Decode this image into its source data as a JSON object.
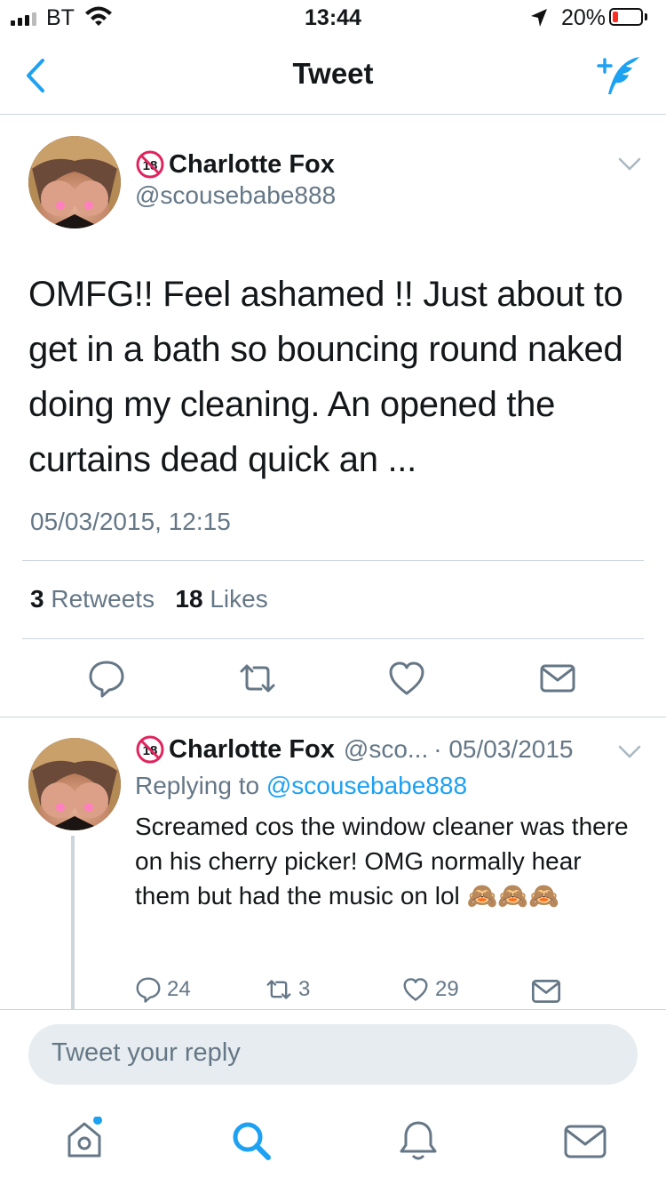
{
  "status_bar": {
    "carrier": "BT",
    "time": "13:44",
    "battery_percent": "20%",
    "battery_level": 0.2,
    "battery_color": "#ff2d20"
  },
  "nav": {
    "title": "Tweet",
    "back_icon": "chevron-left-icon",
    "compose_icon": "compose-tweet-icon",
    "accent": "#1da1f2"
  },
  "tweet": {
    "name": "Charlotte Fox",
    "handle": "@scousebabe888",
    "badge_icon": "eighteen-plus-icon",
    "text": "OMFG!!  Feel ashamed !!  Just about to get in a bath so bouncing round naked doing my cleaning. An opened the curtains dead quick an ...",
    "timestamp": "05/03/2015, 12:15",
    "retweets_count": "3",
    "retweets_label": "Retweets",
    "likes_count": "18",
    "likes_label": "Likes"
  },
  "reply": {
    "name": "Charlotte Fox",
    "handle": "@sco...",
    "date": "· 05/03/2015",
    "replying_prefix": "Replying to",
    "replying_handle": "@scousebabe888",
    "text": "Screamed cos the window cleaner was there on his cherry picker! OMG normally hear them but had the music on lol",
    "emoji": "🙈🙈🙈",
    "reply_count": "24",
    "retweet_count": "3",
    "like_count": "29"
  },
  "reply_box": {
    "placeholder": "Tweet your reply"
  },
  "tab_bar": {
    "items": [
      "home-icon",
      "search-icon",
      "notifications-icon",
      "messages-icon"
    ]
  }
}
